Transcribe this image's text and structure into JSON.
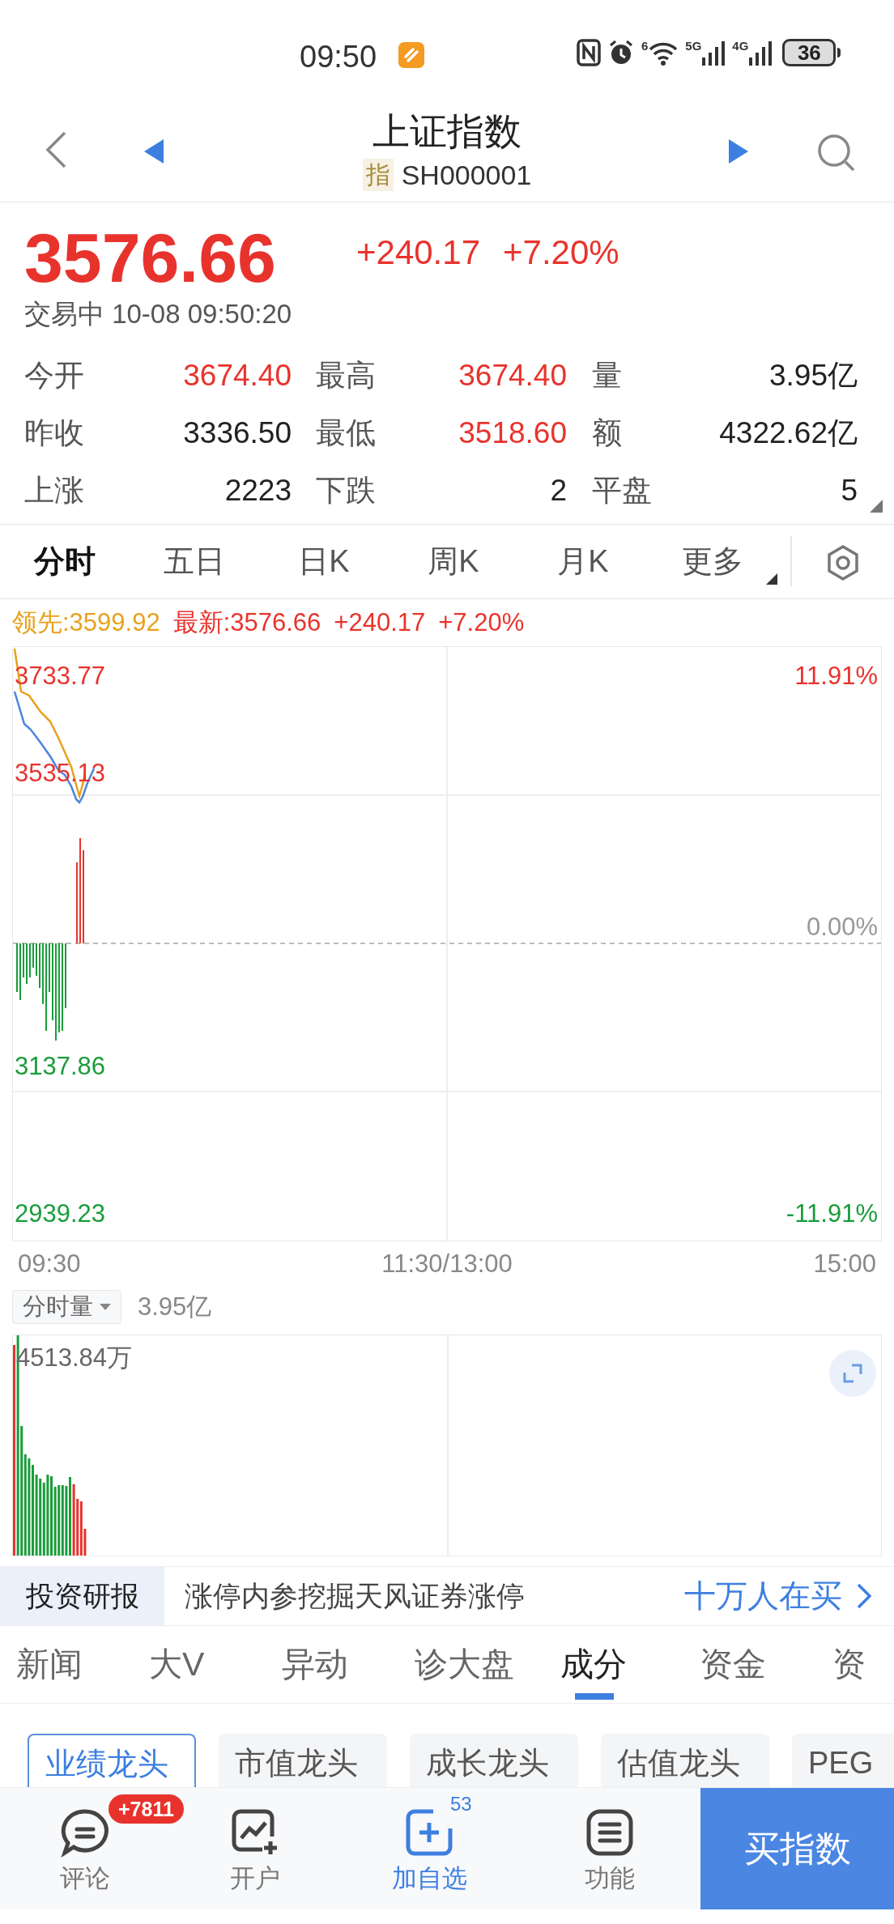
{
  "status_bar": {
    "time": "09:50",
    "wifi_label": "6",
    "signals": [
      "5G",
      "4G"
    ],
    "battery": "36"
  },
  "header": {
    "title": "上证指数",
    "badge": "指",
    "code": "SH000001"
  },
  "quote": {
    "price": "3576.66",
    "change": "+240.17",
    "change_pct": "+7.20%",
    "status": "交易中 10-08 09:50:20"
  },
  "stats": [
    [
      {
        "label": "今开",
        "value": "3674.40",
        "kind": "up"
      },
      {
        "label": "最高",
        "value": "3674.40",
        "kind": "up"
      },
      {
        "label": "量",
        "value": "3.95亿",
        "kind": "neutral"
      }
    ],
    [
      {
        "label": "昨收",
        "value": "3336.50",
        "kind": "neutral"
      },
      {
        "label": "最低",
        "value": "3518.60",
        "kind": "up"
      },
      {
        "label": "额",
        "value": "4322.62亿",
        "kind": "neutral"
      }
    ],
    [
      {
        "label": "上涨",
        "value": "2223",
        "kind": "neutral"
      },
      {
        "label": "下跌",
        "value": "2",
        "kind": "neutral"
      },
      {
        "label": "平盘",
        "value": "5",
        "kind": "neutral"
      }
    ]
  ],
  "chart_tabs": [
    {
      "label": "分时",
      "selected": true
    },
    {
      "label": "五日",
      "selected": false
    },
    {
      "label": "日K",
      "selected": false
    },
    {
      "label": "周K",
      "selected": false
    },
    {
      "label": "月K",
      "selected": false
    },
    {
      "label": "更多",
      "selected": false
    }
  ],
  "legend": {
    "lead": "领先:3599.92",
    "latest": "最新:3576.66",
    "change": "+240.17",
    "change_pct": "+7.20%"
  },
  "chart": {
    "left_labels": [
      {
        "text": "3733.77",
        "kind": "up"
      },
      {
        "text": "3535.13",
        "kind": "up"
      },
      {
        "text": "3137.86",
        "kind": "down"
      },
      {
        "text": "2939.23",
        "kind": "down"
      }
    ],
    "right_labels": [
      {
        "text": "11.91%",
        "kind": "up"
      },
      {
        "text": "0.00%",
        "kind": "neutral"
      },
      {
        "text": "-11.91%",
        "kind": "down"
      }
    ],
    "time_labels": [
      "09:30",
      "11:30/13:00",
      "15:00"
    ]
  },
  "volume": {
    "selector": "分时量",
    "total": "3.95亿",
    "max_label": "4513.84万"
  },
  "banner": {
    "tag": "投资研报",
    "text": "涨停内参挖掘天风证券涨停",
    "link": "十万人在买"
  },
  "news_tabs": [
    {
      "label": "新闻",
      "selected": false
    },
    {
      "label": "大V",
      "selected": false
    },
    {
      "label": "异动",
      "selected": false
    },
    {
      "label": "诊大盘",
      "selected": false
    },
    {
      "label": "成分",
      "selected": true
    },
    {
      "label": "资金",
      "selected": false
    },
    {
      "label": "资",
      "selected": false
    }
  ],
  "chips": [
    {
      "label": "业绩龙头",
      "selected": true
    },
    {
      "label": "市值龙头",
      "selected": false
    },
    {
      "label": "成长龙头",
      "selected": false
    },
    {
      "label": "估值龙头",
      "selected": false
    },
    {
      "label": "PEG",
      "selected": false
    }
  ],
  "bottom_nav": [
    {
      "label": "评论",
      "kind": "comment",
      "badge": "+7811",
      "selected": false
    },
    {
      "label": "开户",
      "kind": "account",
      "selected": false
    },
    {
      "label": "加自选",
      "kind": "add",
      "count": "53",
      "selected": true
    },
    {
      "label": "功能",
      "kind": "menu",
      "selected": false
    }
  ],
  "buy_button": "买指数"
}
